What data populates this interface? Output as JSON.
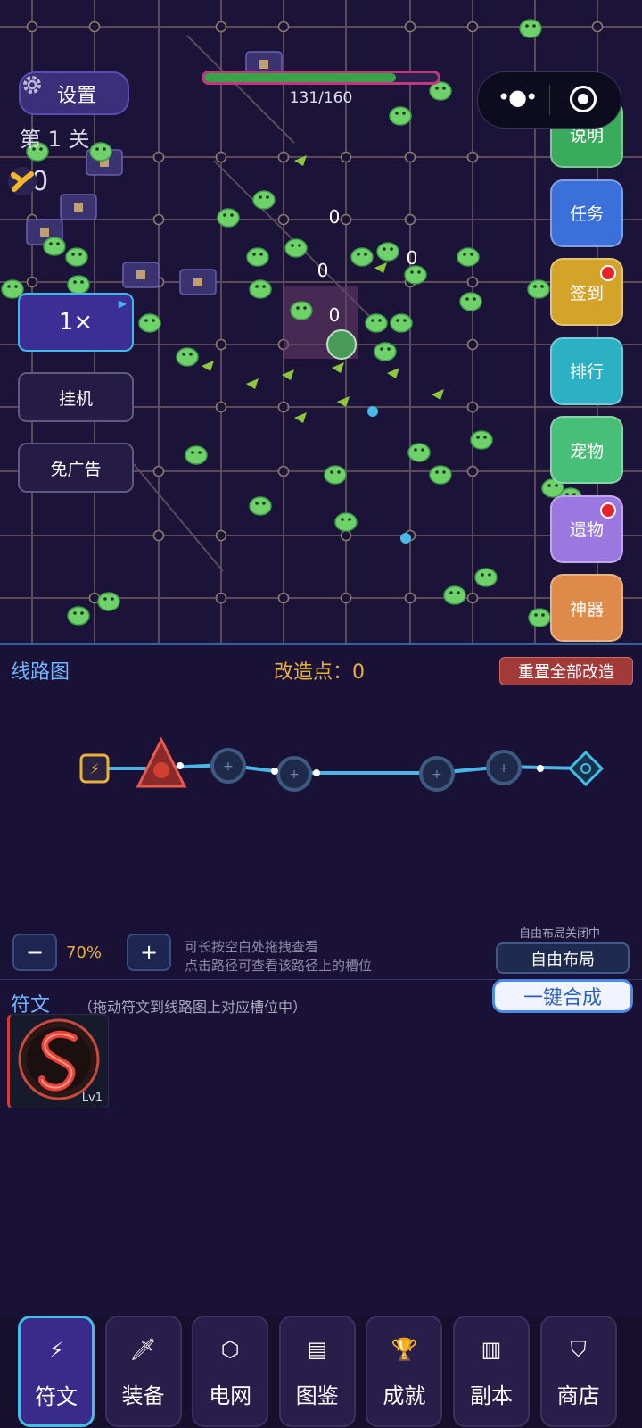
{
  "battle": {
    "hp_text": "131/160",
    "hp_fraction": 0.82,
    "settings_label": "设置",
    "level_label": "第 1 关",
    "coin_value": "10",
    "speed_label": "1×",
    "idle_label": "挂机",
    "no_ads_label": "免广告",
    "damage_numbers": [
      "0",
      "0",
      "0",
      "0"
    ]
  },
  "right_menu": [
    {
      "label": "说明",
      "color": "#3aaa5c",
      "badge": false
    },
    {
      "label": "任务",
      "color": "#3b6fd9",
      "badge": false
    },
    {
      "label": "签到",
      "color": "#d4a42a",
      "badge": true
    },
    {
      "label": "排行",
      "color": "#2bb0c4",
      "badge": false
    },
    {
      "label": "宠物",
      "color": "#48bf78",
      "badge": false
    },
    {
      "label": "遗物",
      "color": "#9b78e0",
      "badge": true
    },
    {
      "label": "神器",
      "color": "#dd8a4a",
      "badge": false
    }
  ],
  "circuit": {
    "title": "线路图",
    "mod_points": "改造点：0",
    "reset_label": "重置全部改造",
    "zoom_minus": "−",
    "zoom_value": "70%",
    "zoom_plus": "+",
    "hint_line1": "可长按空白处拖拽查看",
    "hint_line2": "点击路径可查看该路径上的槽位",
    "layout_status": "自由布局关闭中",
    "layout_button": "自由布局"
  },
  "runes": {
    "title": "符文",
    "hint": "（拖动符文到线路图上对应槽位中）",
    "merge_button": "一键合成",
    "items": [
      {
        "level": "Lv1",
        "icon": "serpent-rune-icon"
      }
    ]
  },
  "nav": [
    {
      "label": "符文",
      "icon": "lightning-icon",
      "glyph": "⚡",
      "active": true
    },
    {
      "label": "装备",
      "icon": "sword-icon",
      "glyph": "🗡",
      "active": false
    },
    {
      "label": "电网",
      "icon": "hexagon-icon",
      "glyph": "⬡",
      "active": false
    },
    {
      "label": "图鉴",
      "icon": "book-icon",
      "glyph": "▤",
      "active": false
    },
    {
      "label": "成就",
      "icon": "trophy-icon",
      "glyph": "🏆",
      "active": false
    },
    {
      "label": "副本",
      "icon": "castle-icon",
      "glyph": "▥",
      "active": false
    },
    {
      "label": "商店",
      "icon": "shop-bag-icon",
      "glyph": "⛉",
      "active": false
    }
  ],
  "colors": {
    "background": "#1a1236",
    "accent": "#3fc0e6",
    "highlight": "#e8b13a",
    "slime": "#6ed16a"
  }
}
